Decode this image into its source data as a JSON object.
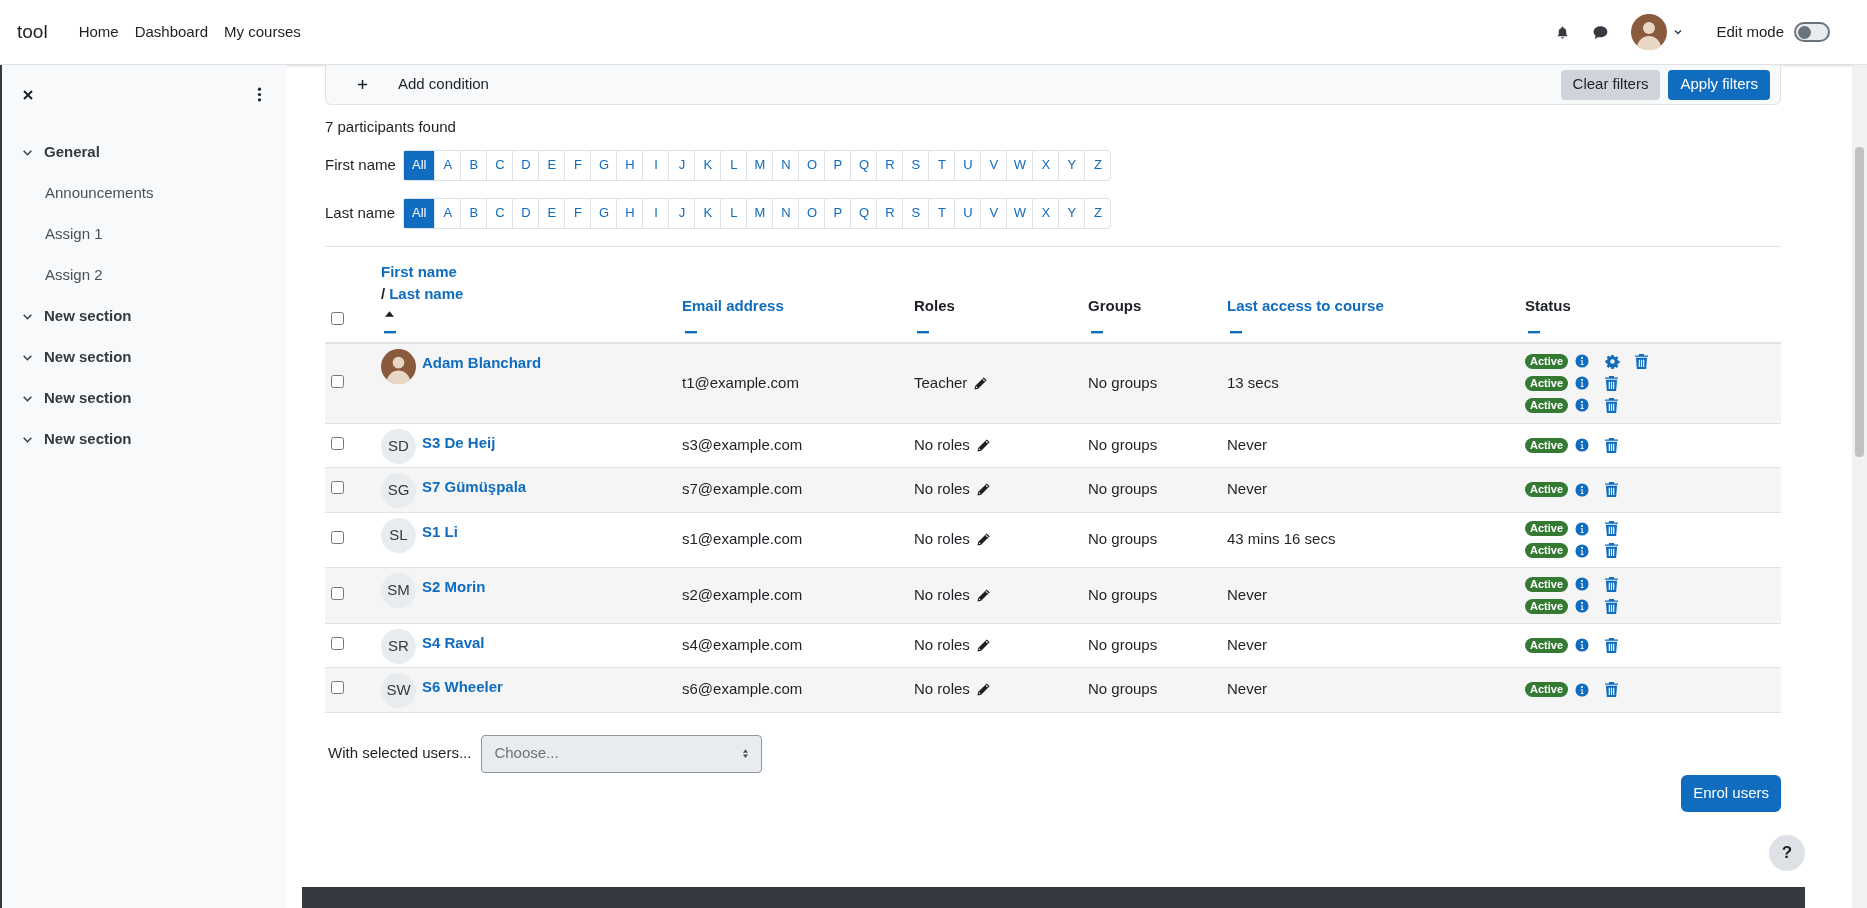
{
  "header": {
    "site_name": "tool",
    "nav": [
      {
        "label": "Home"
      },
      {
        "label": "Dashboard"
      },
      {
        "label": "My courses"
      }
    ],
    "edit_mode": {
      "label": "Edit mode",
      "on": false
    }
  },
  "sidebar": {
    "items": [
      {
        "label": "General",
        "expanded": true,
        "children": [
          {
            "label": "Announcements"
          },
          {
            "label": "Assign 1"
          },
          {
            "label": "Assign 2"
          }
        ]
      },
      {
        "label": "New section",
        "expanded": true
      },
      {
        "label": "New section",
        "expanded": true
      },
      {
        "label": "New section",
        "expanded": true
      },
      {
        "label": "New section",
        "expanded": true
      }
    ]
  },
  "filters": {
    "add_condition": "Add condition",
    "buttons": [
      {
        "label": "Clear filters",
        "kind": "secondary"
      },
      {
        "label": "Apply filters",
        "kind": "primary"
      }
    ]
  },
  "participants_found": "7 participants found",
  "initials_bars": [
    {
      "label": "First name",
      "letters": [
        {
          "label": "All",
          "selected": true
        },
        {
          "label": "A",
          "selected": false
        },
        {
          "label": "B",
          "selected": false
        },
        {
          "label": "C",
          "selected": false
        },
        {
          "label": "D",
          "selected": false
        },
        {
          "label": "E",
          "selected": false
        },
        {
          "label": "F",
          "selected": false
        },
        {
          "label": "G",
          "selected": false
        },
        {
          "label": "H",
          "selected": false
        },
        {
          "label": "I",
          "selected": false
        },
        {
          "label": "J",
          "selected": false
        },
        {
          "label": "K",
          "selected": false
        },
        {
          "label": "L",
          "selected": false
        },
        {
          "label": "M",
          "selected": false
        },
        {
          "label": "N",
          "selected": false
        },
        {
          "label": "O",
          "selected": false
        },
        {
          "label": "P",
          "selected": false
        },
        {
          "label": "Q",
          "selected": false
        },
        {
          "label": "R",
          "selected": false
        },
        {
          "label": "S",
          "selected": false
        },
        {
          "label": "T",
          "selected": false
        },
        {
          "label": "U",
          "selected": false
        },
        {
          "label": "V",
          "selected": false
        },
        {
          "label": "W",
          "selected": false
        },
        {
          "label": "X",
          "selected": false
        },
        {
          "label": "Y",
          "selected": false
        },
        {
          "label": "Z",
          "selected": false
        }
      ]
    },
    {
      "label": "Last name",
      "letters": [
        {
          "label": "All",
          "selected": true
        },
        {
          "label": "A",
          "selected": false
        },
        {
          "label": "B",
          "selected": false
        },
        {
          "label": "C",
          "selected": false
        },
        {
          "label": "D",
          "selected": false
        },
        {
          "label": "E",
          "selected": false
        },
        {
          "label": "F",
          "selected": false
        },
        {
          "label": "G",
          "selected": false
        },
        {
          "label": "H",
          "selected": false
        },
        {
          "label": "I",
          "selected": false
        },
        {
          "label": "J",
          "selected": false
        },
        {
          "label": "K",
          "selected": false
        },
        {
          "label": "L",
          "selected": false
        },
        {
          "label": "M",
          "selected": false
        },
        {
          "label": "N",
          "selected": false
        },
        {
          "label": "O",
          "selected": false
        },
        {
          "label": "P",
          "selected": false
        },
        {
          "label": "Q",
          "selected": false
        },
        {
          "label": "R",
          "selected": false
        },
        {
          "label": "S",
          "selected": false
        },
        {
          "label": "T",
          "selected": false
        },
        {
          "label": "U",
          "selected": false
        },
        {
          "label": "V",
          "selected": false
        },
        {
          "label": "W",
          "selected": false
        },
        {
          "label": "X",
          "selected": false
        },
        {
          "label": "Y",
          "selected": false
        },
        {
          "label": "Z",
          "selected": false
        }
      ]
    }
  ],
  "table": {
    "select_all_checked": false,
    "columns": [
      {
        "label": "First name",
        "separator": "/",
        "second_label": "Last name",
        "sortable": true,
        "sorted": true
      },
      {
        "label": "Email address",
        "sortable": true,
        "sorted": false
      },
      {
        "label": "Roles",
        "sortable": false,
        "sorted": false
      },
      {
        "label": "Groups",
        "sortable": false,
        "sorted": false
      },
      {
        "label": "Last access to course",
        "sortable": true,
        "sorted": false
      },
      {
        "label": "Status",
        "sortable": false,
        "sorted": false
      }
    ],
    "rows": [
      {
        "checked": false,
        "avatar": {
          "kind": "photo"
        },
        "name": "Adam Blanchard",
        "email": "t1@example.com",
        "role": "Teacher",
        "groups": "No groups",
        "last_access": "13 secs",
        "enrolments": [
          {
            "status": "Active",
            "manage": true
          },
          {
            "status": "Active",
            "manage": false
          },
          {
            "status": "Active",
            "manage": false
          }
        ]
      },
      {
        "checked": false,
        "avatar": {
          "kind": "initials",
          "text": "SD"
        },
        "name": "S3 De Heij",
        "email": "s3@example.com",
        "role": "No roles",
        "groups": "No groups",
        "last_access": "Never",
        "enrolments": [
          {
            "status": "Active",
            "manage": false
          }
        ]
      },
      {
        "checked": false,
        "avatar": {
          "kind": "initials",
          "text": "SG"
        },
        "name": "S7 Gümüşpala",
        "email": "s7@example.com",
        "role": "No roles",
        "groups": "No groups",
        "last_access": "Never",
        "enrolments": [
          {
            "status": "Active",
            "manage": false
          }
        ]
      },
      {
        "checked": false,
        "avatar": {
          "kind": "initials",
          "text": "SL"
        },
        "name": "S1 Li",
        "email": "s1@example.com",
        "role": "No roles",
        "groups": "No groups",
        "last_access": "43 mins 16 secs",
        "enrolments": [
          {
            "status": "Active",
            "manage": false
          },
          {
            "status": "Active",
            "manage": false
          }
        ]
      },
      {
        "checked": false,
        "avatar": {
          "kind": "initials",
          "text": "SM"
        },
        "name": "S2 Morin",
        "email": "s2@example.com",
        "role": "No roles",
        "groups": "No groups",
        "last_access": "Never",
        "enrolments": [
          {
            "status": "Active",
            "manage": false
          },
          {
            "status": "Active",
            "manage": false
          }
        ]
      },
      {
        "checked": false,
        "avatar": {
          "kind": "initials",
          "text": "SR"
        },
        "name": "S4 Raval",
        "email": "s4@example.com",
        "role": "No roles",
        "groups": "No groups",
        "last_access": "Never",
        "enrolments": [
          {
            "status": "Active",
            "manage": false
          }
        ]
      },
      {
        "checked": false,
        "avatar": {
          "kind": "initials",
          "text": "SW"
        },
        "name": "S6 Wheeler",
        "email": "s6@example.com",
        "role": "No roles",
        "groups": "No groups",
        "last_access": "Never",
        "enrolments": [
          {
            "status": "Active",
            "manage": false
          }
        ]
      }
    ]
  },
  "bulk_action": {
    "label": "With selected users...",
    "select": {
      "value": "Choose...",
      "disabled": true
    }
  },
  "enrol_button": "Enrol users",
  "help_button": "?"
}
